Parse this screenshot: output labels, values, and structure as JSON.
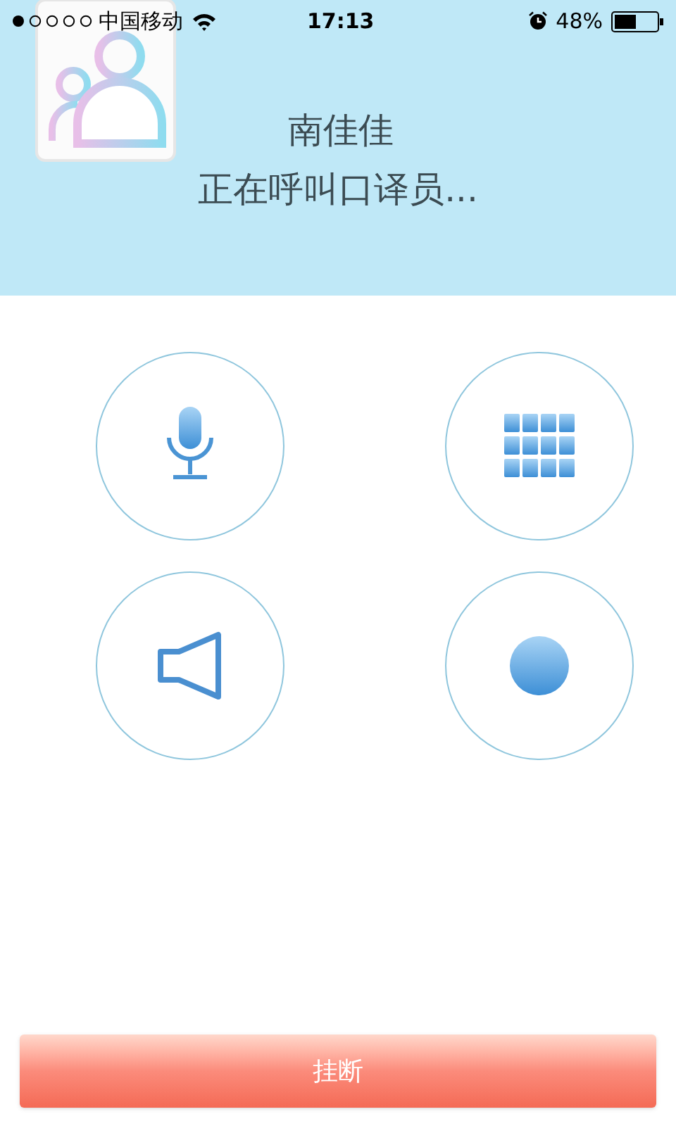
{
  "status_bar": {
    "carrier": "中国移动",
    "time": "17:13",
    "battery_percent": "48%"
  },
  "header": {
    "name": "南佳佳",
    "status": "正在呼叫口译员..."
  },
  "controls": [
    {
      "kind": "mic"
    },
    {
      "kind": "keypad"
    },
    {
      "kind": "speaker"
    },
    {
      "kind": "record"
    }
  ],
  "hangup_button": {
    "label": "挂断"
  }
}
